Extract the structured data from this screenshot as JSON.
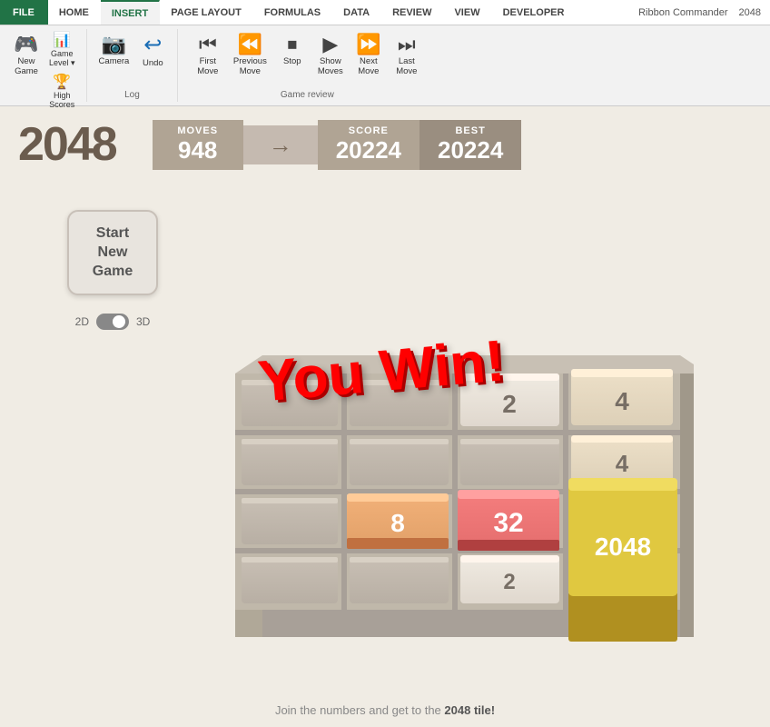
{
  "ribbon": {
    "file_tab": "FILE",
    "tabs": [
      "HOME",
      "INSERT",
      "PAGE LAYOUT",
      "FORMULAS",
      "DATA",
      "REVIEW",
      "VIEW",
      "DEVELOPER"
    ],
    "ribbon_commander": "Ribbon Commander",
    "version": "2048",
    "groups": {
      "game": {
        "label": "",
        "buttons": [
          {
            "id": "new-game",
            "icon": "🎮",
            "label": "New\nGame"
          },
          {
            "id": "game-level",
            "icon": "📊",
            "label": "Game\nLevel"
          },
          {
            "id": "high-scores",
            "icon": "🏆",
            "label": "High\nScores"
          }
        ]
      },
      "log": {
        "label": "Log",
        "buttons": [
          {
            "id": "camera",
            "icon": "📷",
            "label": "Camera"
          },
          {
            "id": "undo",
            "icon": "↩",
            "label": "Undo"
          }
        ]
      },
      "game-review": {
        "label": "Game review",
        "buttons": [
          {
            "id": "first-move",
            "icon": "⏮",
            "label": "First\nMove"
          },
          {
            "id": "previous-move",
            "icon": "⏪",
            "label": "Previous\nMove"
          },
          {
            "id": "stop",
            "icon": "⏹",
            "label": "Stop"
          },
          {
            "id": "show-moves",
            "icon": "▶",
            "label": "Show\nMoves"
          },
          {
            "id": "next",
            "icon": "⏩",
            "label": "Next\nMove"
          },
          {
            "id": "last-move",
            "icon": "⏭",
            "label": "Last\nMove"
          }
        ]
      }
    }
  },
  "game": {
    "title": "2048",
    "moves_label": "MOVES",
    "moves_value": "948",
    "score_label": "SCORE",
    "score_value": "20224",
    "best_label": "BEST",
    "best_value": "20224",
    "you_win_text": "You Win!",
    "start_btn": "Start New Game",
    "toggle_2d": "2D",
    "toggle_3d": "3D",
    "footer": "Join the numbers and get to the 2048 tile!"
  }
}
